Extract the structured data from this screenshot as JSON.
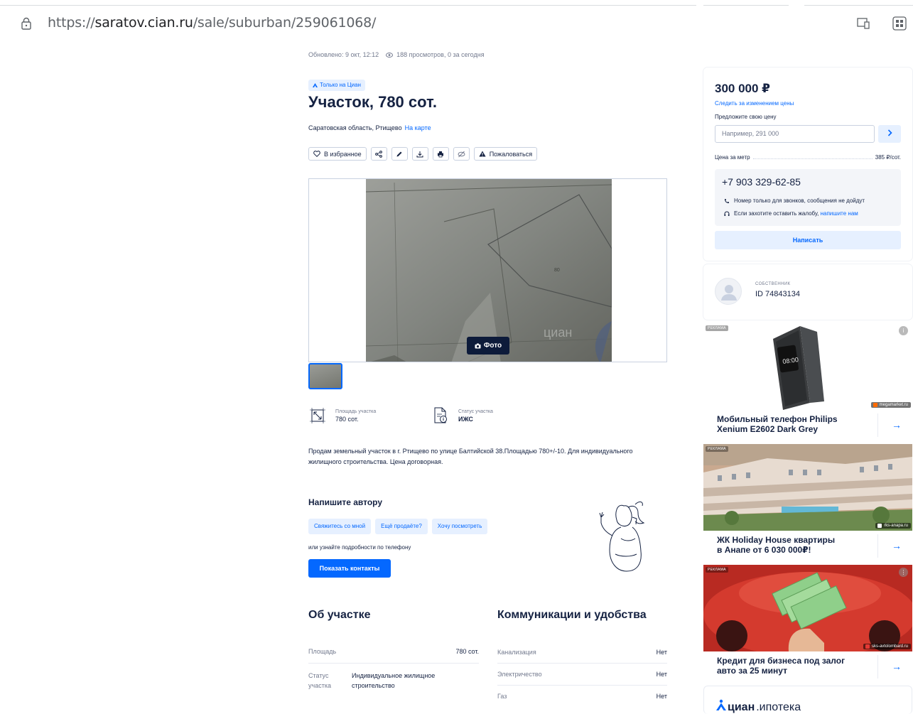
{
  "browser": {
    "url_prefix": "https://",
    "url_host": "saratov.cian.ru",
    "url_path": "/sale/suburban/259061068/"
  },
  "listing": {
    "updated": "Обновлено: 9 окт, 12:12",
    "views": "188 просмотров, 0 за сегодня",
    "only_badge": "Только на Циан",
    "title": "Участок, 780 сот.",
    "address": "Саратовская область, Ртищево",
    "map_link": "На карте",
    "actions": {
      "favorite": "В избранное",
      "report": "Пожаловаться"
    },
    "photo_button": "Фото",
    "facts": [
      {
        "label": "Площадь участка",
        "value": "780 сот."
      },
      {
        "label": "Статус участка",
        "value": "ИЖС"
      }
    ],
    "description": "Продам земельный участок в г. Ртищево по улице Балтийской 38.Площадью 780+/-10. Для индивидуального жилищного строительства. Цена договорная."
  },
  "write_author": {
    "title": "Напишите автору",
    "chips": [
      "Свяжитесь со мной",
      "Ещё продаёте?",
      "Хочу посмотреть"
    ],
    "or_phone": "или узнайте подробности по телефону",
    "show_contacts": "Показать контакты"
  },
  "about": {
    "title": "Об участке",
    "rows": [
      {
        "k": "Площадь",
        "v": "780 сот."
      },
      {
        "k1": "Статус",
        "k2": "участка",
        "v1": "Индивидуальное жилищное",
        "v2": "строительство"
      }
    ]
  },
  "communications": {
    "title": "Коммуникации и удобства",
    "rows": [
      {
        "k": "Канализация",
        "v": "Нет"
      },
      {
        "k": "Электричество",
        "v": "Нет"
      },
      {
        "k": "Газ",
        "v": "Нет"
      }
    ]
  },
  "price_card": {
    "price": "300 000 ₽",
    "follow": "Следить за изменением цены",
    "offer_label": "Предложите свою цену",
    "offer_placeholder": "Например, 291 000",
    "ppm_label": "Цена за метр",
    "ppm_value": "385 ₽/сот.",
    "phone": "+7 903 329-62-85",
    "note_calls": "Номер только для звонков, сообщения не дойдут",
    "note_complaint": "Если захотите оставить жалобу,",
    "note_complaint_link": "напишите нам",
    "write_button": "Написать"
  },
  "owner": {
    "role": "СОБСТВЕННИК",
    "id": "ID 74843134"
  },
  "ads": [
    {
      "tag": "РЕКЛАМА",
      "source": "megamarket.ru",
      "caption1": "Мобильный телефон Philips",
      "caption2": "Xenium E2602 Dark Grey",
      "info": "i"
    },
    {
      "tag": "РЕКЛАМА",
      "source": "rks-anapa.ru",
      "caption1": "ЖК Holiday House квартиры",
      "caption2": "в Анапе от 6 030 000₽!"
    },
    {
      "tag": "РЕКЛАМА",
      "source": "sks-avtolombard.ru",
      "caption1": "Кредит для бизнеса под залог",
      "caption2": "авто за 25 минут",
      "info": "⋮"
    }
  ],
  "ipoteka": {
    "brand": "циан",
    "suffix": ".ипотека"
  },
  "colors": {
    "accent": "#0468ff",
    "text": "#152242",
    "muted": "#737a8e"
  }
}
